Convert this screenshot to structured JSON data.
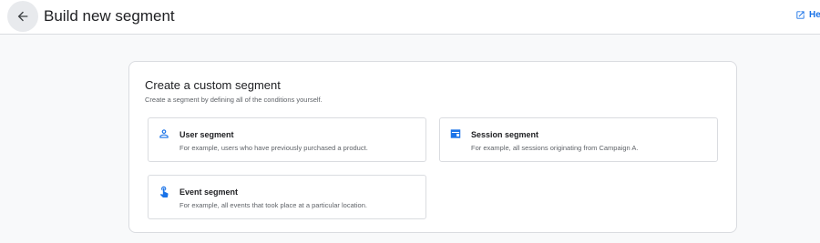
{
  "header": {
    "title": "Build new segment",
    "back_icon": "arrow-back-icon",
    "help": {
      "label": "He",
      "icon": "open-in-new-icon"
    }
  },
  "card": {
    "title": "Create a custom segment",
    "subtitle": "Create a segment by defining all of the conditions yourself.",
    "options": [
      {
        "title": "User segment",
        "description": "For example, users who have previously purchased a product.",
        "icon": "person-icon"
      },
      {
        "title": "Session segment",
        "description": "For example, all sessions originating from Campaign A.",
        "icon": "session-icon"
      },
      {
        "title": "Event segment",
        "description": "For example, all events that took place at a particular location.",
        "icon": "touch-icon"
      }
    ]
  },
  "colors": {
    "accent": "#1a73e8",
    "border": "#dadce0",
    "background": "#f8f9fa"
  }
}
